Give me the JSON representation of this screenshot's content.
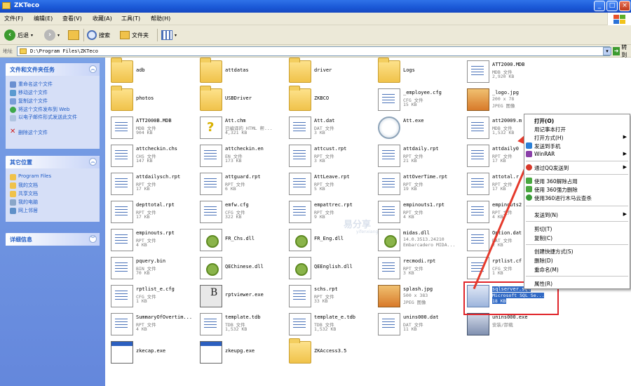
{
  "window": {
    "title": "ZKTeco"
  },
  "menu": [
    "文件(F)",
    "编辑(E)",
    "查看(V)",
    "收藏(A)",
    "工具(T)",
    "帮助(H)"
  ],
  "toolbar": {
    "back": "后退",
    "search": "搜索",
    "folders": "文件夹"
  },
  "address": {
    "label": "地址",
    "path": "D:\\Program Files\\ZKTeco",
    "go": "转到"
  },
  "left": {
    "tasks_title": "文件和文件夹任务",
    "tasks": [
      "重命名这个文件",
      "移动这个文件",
      "复制这个文件",
      "将这个文件发布到 Web",
      "以电子邮件形式发送此文件",
      "删除这个文件"
    ],
    "places_title": "其它位置",
    "places": [
      "Program Files",
      "我的文档",
      "共享文档",
      "我的电脑",
      "网上邻居"
    ],
    "details_title": "详细信息"
  },
  "files": [
    {
      "name": "adb",
      "type": "folder"
    },
    {
      "name": "attdatas",
      "type": "folder"
    },
    {
      "name": "driver",
      "type": "folder"
    },
    {
      "name": "Logs",
      "type": "folder"
    },
    {
      "name": "ATT2000.MDB",
      "type": "doc",
      "desc": "MDB 文件",
      "size": "2,920 KB"
    },
    {
      "name": "photos",
      "type": "folder"
    },
    {
      "name": "USBDriver",
      "type": "folder"
    },
    {
      "name": "ZKBCO",
      "type": "folder"
    },
    {
      "name": "_employee.cfg",
      "type": "doc",
      "desc": "CFG 文件",
      "size": "15 KB"
    },
    {
      "name": "_logo.jpg",
      "type": "img",
      "desc": "200 x 78",
      "size": "JPEG 图像"
    },
    {
      "name": "ATT2000B.MDB",
      "type": "doc",
      "desc": "MDB 文件",
      "size": "904 KB"
    },
    {
      "name": "Att.chm",
      "type": "chm",
      "desc": "已编译的 HTML 帮...",
      "size": "4,321 KB"
    },
    {
      "name": "Att.dat",
      "type": "doc",
      "desc": "DAT 文件",
      "size": "3 KB"
    },
    {
      "name": "Att.exe",
      "type": "clock",
      "desc": "",
      "size": ""
    },
    {
      "name": "att20009.m",
      "type": "doc",
      "desc": "MDB 文件",
      "size": "1,532 KB"
    },
    {
      "name": "attcheckin.chs",
      "type": "doc",
      "desc": "CHS 文件",
      "size": "147 KB"
    },
    {
      "name": "attcheckin.en",
      "type": "doc",
      "desc": "EN 文件",
      "size": "173 KB"
    },
    {
      "name": "attcust.rpt",
      "type": "doc",
      "desc": "RPT 文件",
      "size": "3 KB"
    },
    {
      "name": "attdaily.rpt",
      "type": "doc",
      "desc": "RPT 文件",
      "size": "21 KB"
    },
    {
      "name": "attdaily0",
      "type": "doc",
      "desc": "RPT 文件",
      "size": "17 KB"
    },
    {
      "name": "attdailysch.rpt",
      "type": "doc",
      "desc": "RPT 文件",
      "size": "17 KB"
    },
    {
      "name": "attguard.rpt",
      "type": "doc",
      "desc": "RPT 文件",
      "size": "6 KB"
    },
    {
      "name": "AttLeave.rpt",
      "type": "doc",
      "desc": "RPT 文件",
      "size": "5 KB"
    },
    {
      "name": "attOverTime.rpt",
      "type": "doc",
      "desc": "RPT 文件",
      "size": "19 KB"
    },
    {
      "name": "attotal.r",
      "type": "doc",
      "desc": "RPT 文件",
      "size": "17 KB"
    },
    {
      "name": "depttotal.rpt",
      "type": "doc",
      "desc": "RPT 文件",
      "size": "17 KB"
    },
    {
      "name": "emfw.cfg",
      "type": "doc",
      "desc": "CFG 文件",
      "size": "322 KB"
    },
    {
      "name": "empattrec.rpt",
      "type": "doc",
      "desc": "RPT 文件",
      "size": "9 KB"
    },
    {
      "name": "empinouts1.rpt",
      "type": "doc",
      "desc": "RPT 文件",
      "size": "4 KB"
    },
    {
      "name": "empinouts2",
      "type": "doc",
      "desc": "RPT 文件",
      "size": "4 KB"
    },
    {
      "name": "empinouts.rpt",
      "type": "doc",
      "desc": "RPT 文件",
      "size": "4 KB"
    },
    {
      "name": "FR_Chs.dll",
      "type": "dll",
      "desc": "",
      "size": ""
    },
    {
      "name": "FR_Eng.dll",
      "type": "dll",
      "desc": "",
      "size": ""
    },
    {
      "name": "midas.dll",
      "type": "dll",
      "desc": "14.0.3513.24210",
      "size": "Embarcadero MIDA..."
    },
    {
      "name": "Option.dat",
      "type": "doc",
      "desc": "DAT 文件",
      "size": "2 KB"
    },
    {
      "name": "pquery.bin",
      "type": "doc",
      "desc": "BIN 文件",
      "size": "70 KB"
    },
    {
      "name": "QEChinese.dll",
      "type": "dll",
      "desc": "",
      "size": ""
    },
    {
      "name": "QEEnglish.dll",
      "type": "dll",
      "desc": "",
      "size": ""
    },
    {
      "name": "recmodi.rpt",
      "type": "doc",
      "desc": "RPT 文件",
      "size": "3 KB"
    },
    {
      "name": "rptlist.cf",
      "type": "doc",
      "desc": "CFG 文件",
      "size": "1 KB"
    },
    {
      "name": "rptlist_e.cfg",
      "type": "doc",
      "desc": "CFG 文件",
      "size": "1 KB"
    },
    {
      "name": "rptviewer.exe",
      "type": "exeb",
      "desc": "",
      "size": ""
    },
    {
      "name": "schs.rpt",
      "type": "doc",
      "desc": "RPT 文件",
      "size": "33 KB"
    },
    {
      "name": "splash.jpg",
      "type": "img",
      "desc": "500 x 383",
      "size": "JPEG 图像"
    },
    {
      "name": "sqlserver.sql",
      "type": "sqlic",
      "desc": "Microsoft SQL Se...",
      "size": "18 KB"
    },
    {
      "name": "SummaryOfOvertim...",
      "type": "doc",
      "desc": "RPT 文件",
      "size": "4 KB"
    },
    {
      "name": "template.tdb",
      "type": "doc",
      "desc": "TDB 文件",
      "size": "1,532 KB"
    },
    {
      "name": "template_e.tdb",
      "type": "doc",
      "desc": "TDB 文件",
      "size": "1,532 KB"
    },
    {
      "name": "unins000.dat",
      "type": "doc",
      "desc": "DAT 文件",
      "size": "11 KB"
    },
    {
      "name": "unins000.exe",
      "type": "inst",
      "desc": "安装/卸载",
      "size": ""
    },
    {
      "name": "zkecap.exe",
      "type": "win",
      "desc": "",
      "size": ""
    },
    {
      "name": "zkeupg.exe",
      "type": "win",
      "desc": "",
      "size": ""
    },
    {
      "name": "ZKAccess3.5",
      "type": "folder"
    }
  ],
  "context_menu": {
    "open": "打开(O)",
    "open_notepad": "用记事本打开",
    "open_with": "打开方式(H)",
    "send_phone": "发送到手机",
    "winrar": "WinRAR",
    "qq_send": "通过QQ发送到",
    "use360_unlock": "使用 360解除占用",
    "use360_delete": "使用 360强力删除",
    "use360_scan": "使用360进行木马云查杀",
    "send_to": "发送到(N)",
    "cut": "剪切(T)",
    "copy": "复制(C)",
    "create_shortcut": "创建快捷方式(S)",
    "delete": "删除(D)",
    "rename": "重命名(M)",
    "properties": "属性(R)"
  },
  "watermark": {
    "main": "易分享",
    "sub": "yifenxiang"
  },
  "colors": {
    "highlight": "#316ac5",
    "annotation": "#e0252a"
  }
}
